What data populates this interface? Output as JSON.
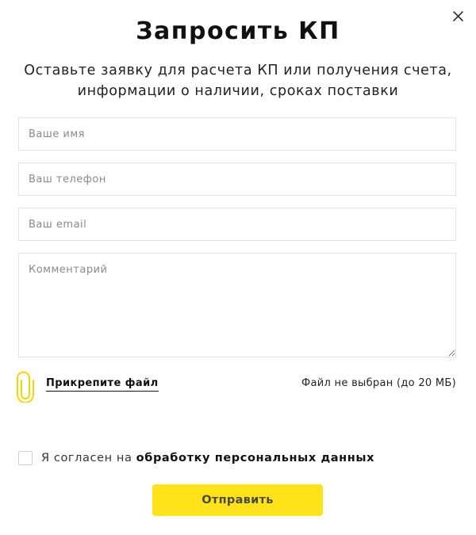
{
  "modal": {
    "title": "Запросить КП",
    "subtitle": "Оставьте заявку для расчета КП или получения счета, информации о наличии, сроках поставки",
    "close_icon": "close-icon"
  },
  "form": {
    "name_placeholder": "Ваше имя",
    "phone_placeholder": "Ваш телефон",
    "email_placeholder": "Ваш email",
    "comment_placeholder": "Комментарий"
  },
  "attachment": {
    "icon": "paperclip-icon",
    "link_label": "Прикрепите файл",
    "status": "Файл не выбран (до 20 МБ)"
  },
  "consent": {
    "checked": false,
    "text": "Я согласен на ",
    "link_label": "обработку персональных данных"
  },
  "submit": {
    "label": "Отправить"
  },
  "colors": {
    "accent": "#ffe31a",
    "icon_accent": "#f4d500",
    "text": "#111111",
    "border": "#e2e2e2"
  }
}
